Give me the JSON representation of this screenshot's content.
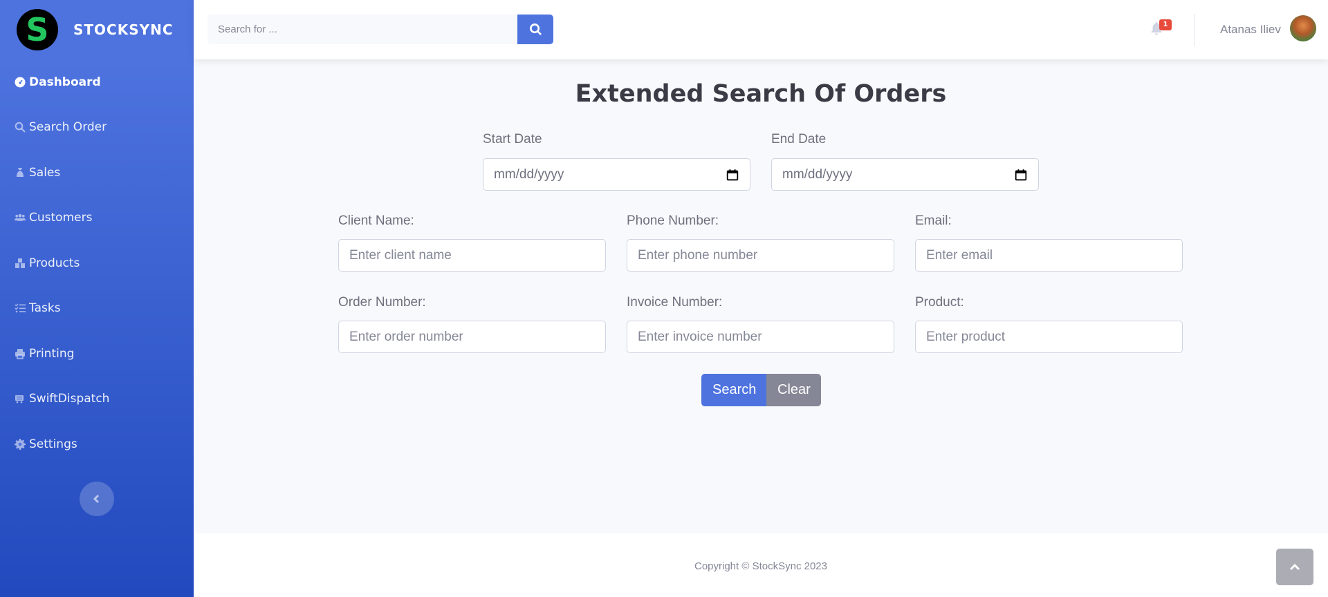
{
  "brand": {
    "logo_letter": "S",
    "name": "STOCKSYNC",
    "logo_color": "#22c55e"
  },
  "sidebar": {
    "items": [
      {
        "label": "Dashboard",
        "icon": "dashboard-icon",
        "active": true
      },
      {
        "label": "Search Order",
        "icon": "search-icon"
      },
      {
        "label": "Sales",
        "icon": "money-bag-icon"
      },
      {
        "label": "Customers",
        "icon": "users-icon"
      },
      {
        "label": "Products",
        "icon": "boxes-icon"
      },
      {
        "label": "Tasks",
        "icon": "list-check-icon"
      },
      {
        "label": "Printing",
        "icon": "printer-icon"
      },
      {
        "label": "SwiftDispatch",
        "icon": "truck-icon"
      },
      {
        "label": "Settings",
        "icon": "gear-icon"
      }
    ],
    "gradient_top": "#4e73df",
    "gradient_bottom": "#224abe"
  },
  "topbar": {
    "search_placeholder": "Search for ...",
    "notification_count": "1",
    "user_name": "Atanas Iliev"
  },
  "main": {
    "title": "Extended Search Of Orders",
    "start_date": {
      "label": "Start Date",
      "value": "mm/dd/yyyy"
    },
    "end_date": {
      "label": "End Date",
      "value": "mm/dd/yyyy"
    },
    "client_name": {
      "label": "Client Name:",
      "placeholder": "Enter client name"
    },
    "phone_number": {
      "label": "Phone Number:",
      "placeholder": "Enter phone number"
    },
    "email": {
      "label": "Email:",
      "placeholder": "Enter email"
    },
    "order_number": {
      "label": "Order Number:",
      "placeholder": "Enter order number"
    },
    "invoice_number": {
      "label": "Invoice Number:",
      "placeholder": "Enter invoice number"
    },
    "product": {
      "label": "Product:",
      "placeholder": "Enter product"
    },
    "search_button": "Search",
    "clear_button": "Clear"
  },
  "footer": {
    "copyright": "Copyright © StockSync 2023"
  }
}
